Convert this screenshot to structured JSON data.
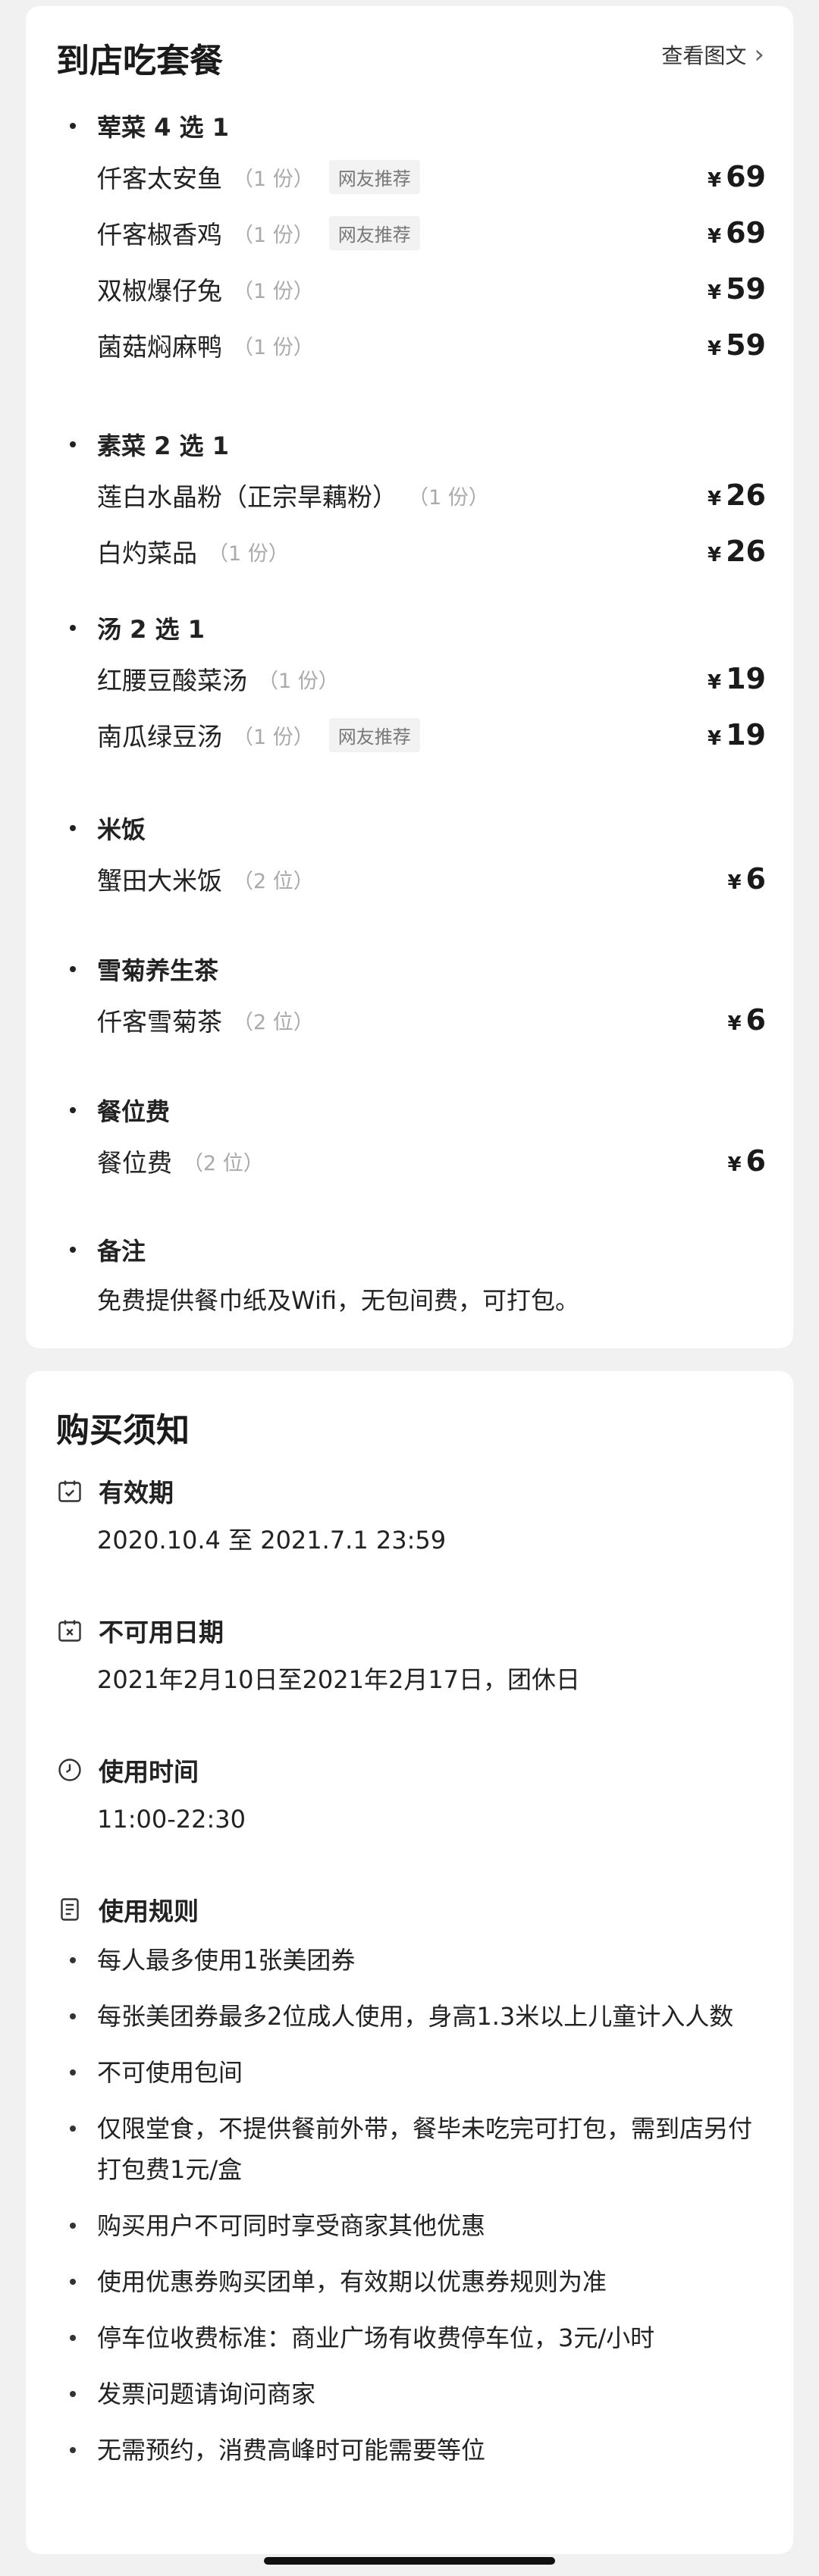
{
  "menu": {
    "title": "到店吃套餐",
    "detail_link": "查看图文",
    "currency": "¥",
    "groups": [
      {
        "title": "荤菜 4 选 1",
        "items": [
          {
            "name": "仟客太安鱼",
            "qty": "（1 份）",
            "tag": "网友推荐",
            "price": "69"
          },
          {
            "name": "仟客椒香鸡",
            "qty": "（1 份）",
            "tag": "网友推荐",
            "price": "69"
          },
          {
            "name": "双椒爆仔兔",
            "qty": "（1 份）",
            "tag": "",
            "price": "59"
          },
          {
            "name": "菌菇焖麻鸭",
            "qty": "（1 份）",
            "tag": "",
            "price": "59"
          }
        ]
      },
      {
        "title": "素菜 2 选 1",
        "items": [
          {
            "name": "莲白水晶粉（正宗旱藕粉）",
            "qty": "（1 份）",
            "tag": "",
            "price": "26"
          },
          {
            "name": "白灼菜品",
            "qty": "（1 份）",
            "tag": "",
            "price": "26"
          }
        ]
      },
      {
        "title": "汤 2 选 1",
        "items": [
          {
            "name": "红腰豆酸菜汤",
            "qty": "（1 份）",
            "tag": "",
            "price": "19"
          },
          {
            "name": "南瓜绿豆汤",
            "qty": "（1 份）",
            "tag": "网友推荐",
            "price": "19"
          }
        ]
      },
      {
        "title": "米饭",
        "items": [
          {
            "name": "蟹田大米饭",
            "qty": "（2 位）",
            "tag": "",
            "price": "6"
          }
        ]
      },
      {
        "title": "雪菊养生茶",
        "items": [
          {
            "name": "仟客雪菊茶",
            "qty": "（2 位）",
            "tag": "",
            "price": "6"
          }
        ]
      },
      {
        "title": "餐位费",
        "items": [
          {
            "name": "餐位费",
            "qty": "（2 位）",
            "tag": "",
            "price": "6"
          }
        ]
      }
    ],
    "remark": {
      "title": "备注",
      "text": "免费提供餐巾纸及Wifi，无包间费，可打包。"
    }
  },
  "notice": {
    "title": "购买须知",
    "validity": {
      "title": "有效期",
      "icon": "calendar-check-icon",
      "text": "2020.10.4 至 2021.7.1 23:59"
    },
    "unavailable": {
      "title": "不可用日期",
      "icon": "calendar-x-icon",
      "text": "2021年2月10日至2021年2月17日，团休日"
    },
    "usage_time": {
      "title": "使用时间",
      "icon": "clock-icon",
      "text": "11:00-22:30"
    },
    "rules": {
      "title": "使用规则",
      "icon": "document-icon",
      "items": [
        "每人最多使用1张美团券",
        "每张美团券最多2位成人使用，身高1.3米以上儿童计入人数",
        "不可使用包间",
        "仅限堂食，不提供餐前外带，餐毕未吃完可打包，需到店另付打包费1元/盒",
        "购买用户不可同时享受商家其他优惠",
        "使用优惠券购买团单，有效期以优惠券规则为准",
        "停车位收费标准：商业广场有收费停车位，3元/小时",
        "发票问题请询问商家",
        "无需预约，消费高峰时可能需要等位"
      ]
    }
  }
}
